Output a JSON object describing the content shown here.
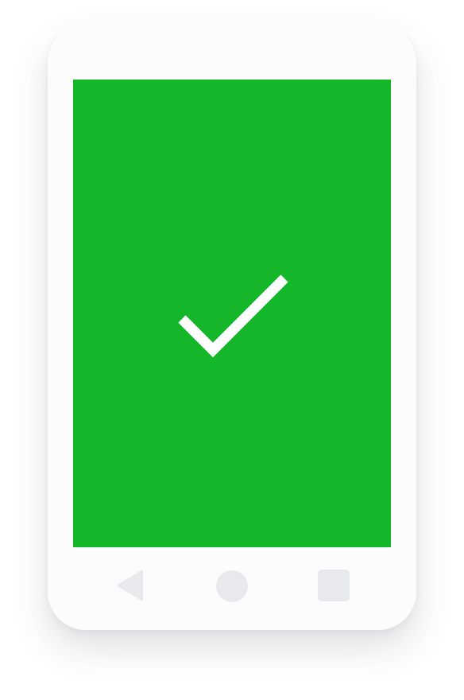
{
  "screen": {
    "state": "success",
    "background_color": "#15b72a",
    "icon": "checkmark-icon",
    "icon_color": "#ffffff"
  },
  "device": {
    "body_color": "#fcfcfc",
    "nav_icon_color": "#e8e9ec"
  },
  "nav_bar": {
    "items": [
      {
        "icon": "back-triangle-icon"
      },
      {
        "icon": "home-circle-icon"
      },
      {
        "icon": "recents-square-icon"
      }
    ]
  }
}
